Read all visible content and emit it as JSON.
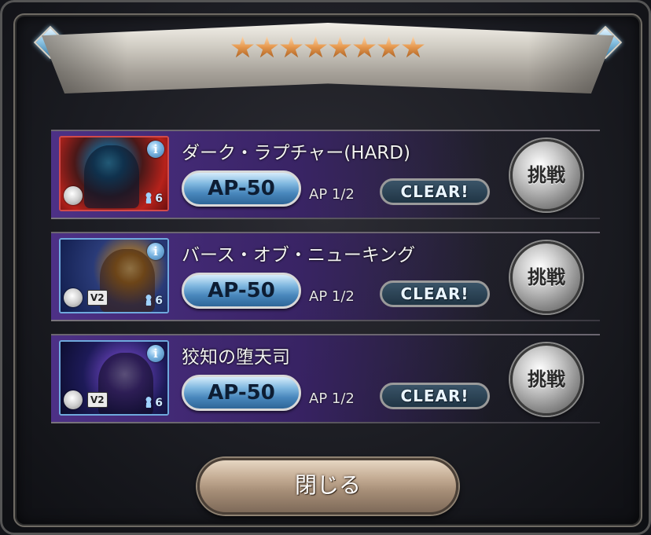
{
  "header": {
    "difficulty_stars": 8
  },
  "quests": [
    {
      "title": "ダーク・ラプチャー(HARD)",
      "ap_cost": "AP-50",
      "ap_remaining": "AP 1/2",
      "clear_label": "CLEAR!",
      "challenge_label": "挑戦",
      "party_count": "6",
      "info_label": "i",
      "version_badge": "",
      "thumb_style": "red"
    },
    {
      "title": "バース・オブ・ニューキング",
      "ap_cost": "AP-50",
      "ap_remaining": "AP 1/2",
      "clear_label": "CLEAR!",
      "challenge_label": "挑戦",
      "party_count": "6",
      "info_label": "i",
      "version_badge": "V2",
      "thumb_style": "blue-gold"
    },
    {
      "title": "狡知の堕天司",
      "ap_cost": "AP-50",
      "ap_remaining": "AP 1/2",
      "clear_label": "CLEAR!",
      "challenge_label": "挑戦",
      "party_count": "6",
      "info_label": "i",
      "version_badge": "V2",
      "thumb_style": "blue-purple"
    }
  ],
  "footer": {
    "close_label": "閉じる"
  },
  "colors": {
    "star": "#e6994f",
    "ap_pill": "#4987bc",
    "row_bg": "#50328c",
    "close_button": "#c3ab93"
  },
  "icons": {
    "info": "info-icon",
    "element": "element-icon",
    "party": "party-icon",
    "gem": "diamond-gem-icon"
  }
}
